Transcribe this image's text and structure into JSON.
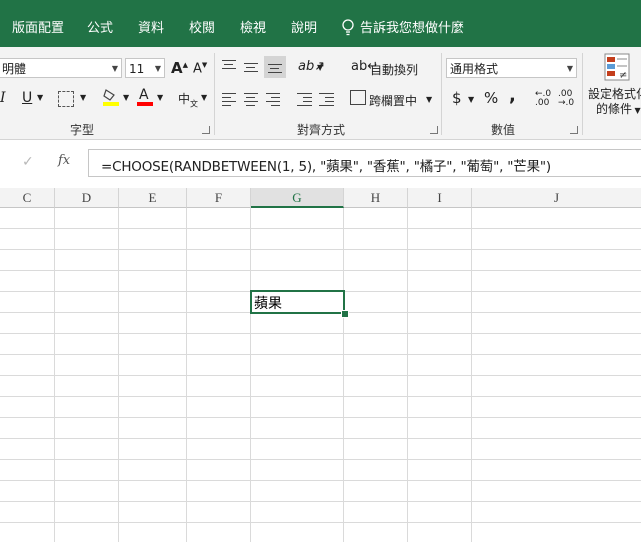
{
  "tabs": [
    "版面配置",
    "公式",
    "資料",
    "校閱",
    "檢視",
    "說明"
  ],
  "tell_me": "告訴我您想做什麼",
  "font": {
    "name": "明體",
    "size": "11"
  },
  "font_buttons": {
    "grow": "A",
    "shrink": "A",
    "italic": "I",
    "underline": "U",
    "font_color": "A",
    "phonetic": "中",
    "phonetic_sub": "文"
  },
  "groups": {
    "font": "字型",
    "alignment": "對齊方式",
    "number": "數值"
  },
  "alignment": {
    "wrap_text": "自動換列",
    "merge_center": "跨欄置中"
  },
  "number": {
    "format": "通用格式",
    "currency": "$",
    "percent": "%",
    "comma": ","
  },
  "styles": {
    "conditional_line1": "設定格式化",
    "conditional_line2": "的條件"
  },
  "formula_bar": {
    "fx": "fx",
    "formula": "=CHOOSE(RANDBETWEEN(1, 5), \"蘋果\", \"香蕉\", \"橘子\", \"葡萄\", \"芒果\")"
  },
  "columns": [
    "C",
    "D",
    "E",
    "F",
    "G",
    "H",
    "I",
    "J"
  ],
  "selected_cell": {
    "column": "G",
    "value": "蘋果"
  },
  "colors": {
    "accent": "#217346",
    "highlight": "#ffff00",
    "font_red": "#ff0000"
  }
}
